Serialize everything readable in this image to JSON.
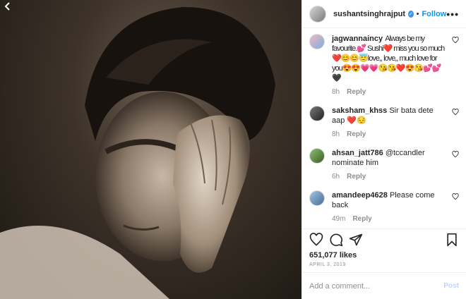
{
  "post": {
    "username": "sushantsinghrajput",
    "follow_label": "Follow",
    "separator": "•",
    "more_label": "•••",
    "likes": "651,077 likes",
    "date": "APRIL 3, 2019",
    "add_comment_placeholder": "Add a comment...",
    "post_label": "Post"
  },
  "comments": [
    {
      "username": "jagwannaincy",
      "text": "Always be my favourite.💕 Sushi❤️ miss you so much❤️😊😊😇love,, love,, much love for you😍😍💗💗😘😘❤️😍😘💕💕🖤",
      "time": "8h",
      "reply_label": "Reply"
    },
    {
      "username": "saksham_khss",
      "text": "Sir bata dete aap ❤️😔",
      "time": "8h",
      "reply_label": "Reply"
    },
    {
      "username": "ahsan_jatt786",
      "text": "@tccandler nominate him",
      "time": "6h",
      "reply_label": "Reply"
    },
    {
      "username": "amandeep4628",
      "text": "Please come back",
      "time": "49m",
      "reply_label": "Reply"
    }
  ],
  "icons": {
    "back": "chevron-left-icon",
    "verified": "verified-badge-icon",
    "like": "heart-icon",
    "comment": "comment-icon",
    "share": "paper-plane-icon",
    "save": "bookmark-icon"
  },
  "colors": {
    "follow": "#0095f6",
    "verified": "#3897f0",
    "muted": "#8e8e8e",
    "post_disabled": "#b3dbff"
  }
}
